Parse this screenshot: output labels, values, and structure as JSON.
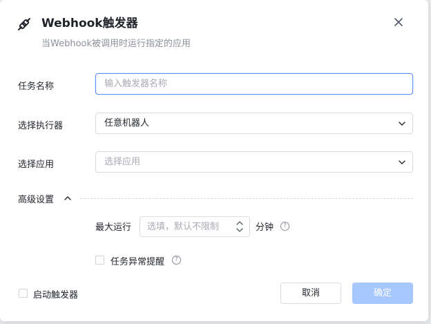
{
  "dialog": {
    "title": "Webhook触发器",
    "subtitle": "当Webhook被调用时运行指定的应用",
    "header_icon": "webhook-link-icon",
    "close_icon": "close-icon"
  },
  "form": {
    "task_name": {
      "label": "任务名称",
      "value": "",
      "placeholder": "输入触发器名称"
    },
    "executor": {
      "label": "选择执行器",
      "value": "任意机器人"
    },
    "app": {
      "label": "选择应用",
      "value": "",
      "placeholder": "选择应用"
    }
  },
  "advanced": {
    "label": "高级设置",
    "expanded": true,
    "max_run": {
      "label": "最大运行",
      "value": "",
      "placeholder": "选填，默认不限制",
      "unit": "分钟"
    },
    "alert": {
      "label": "任务异常提醒",
      "checked": false
    }
  },
  "footer": {
    "enable": {
      "label": "启动触发器",
      "checked": false
    },
    "cancel_label": "取消",
    "ok_label": "确定"
  },
  "colors": {
    "accent_focus": "#5b8ff9",
    "primary_disabled": "#a6c8ff",
    "placeholder": "#a8abb2"
  }
}
